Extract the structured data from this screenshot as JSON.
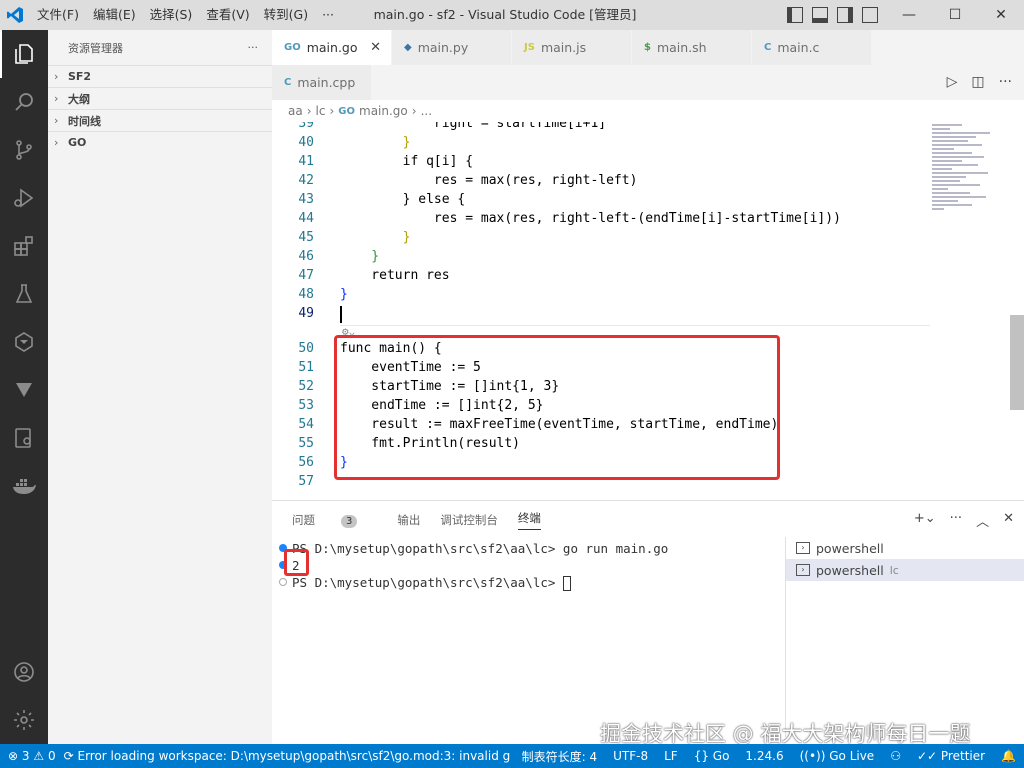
{
  "titlebar": {
    "menu": [
      "文件(F)",
      "编辑(E)",
      "选择(S)",
      "查看(V)",
      "转到(G)",
      "···"
    ],
    "title": "main.go - sf2 - Visual Studio Code [管理员]"
  },
  "sidebar": {
    "title": "资源管理器",
    "sections": [
      "SF2",
      "大纲",
      "时间线",
      "GO"
    ]
  },
  "tabs": [
    {
      "label": "main.go",
      "icon": "GO",
      "active": true,
      "color": "#519aba"
    },
    {
      "label": "main.py",
      "icon": "py",
      "active": false,
      "color": "#3776ab"
    },
    {
      "label": "main.js",
      "icon": "JS",
      "active": false,
      "color": "#cbcb41"
    },
    {
      "label": "main.sh",
      "icon": "$",
      "active": false,
      "color": "#4d5a5e"
    },
    {
      "label": "main.c",
      "icon": "C",
      "active": false,
      "color": "#519aba"
    },
    {
      "label": "main.cpp",
      "icon": "C",
      "active": false,
      "color": "#519aba"
    }
  ],
  "breadcrumb": [
    "aa",
    "lc",
    "main.go",
    "..."
  ],
  "code": {
    "line_numbers": [
      "39",
      "40",
      "41",
      "42",
      "43",
      "44",
      "45",
      "46",
      "47",
      "48",
      "49",
      "50",
      "51",
      "52",
      "53",
      "54",
      "55",
      "56",
      "57"
    ],
    "lines": [
      "            right = startTime[i+1]",
      "        }",
      "        if q[i] {",
      "            res = max(res, right-left)",
      "        } else {",
      "            res = max(res, right-left-(endTime[i]-startTime[i]))",
      "        }",
      "    }",
      "    return res",
      "}",
      "",
      "func main() {",
      "    eventTime := 5",
      "    startTime := []int{1, 3}",
      "    endTime := []int{2, 5}",
      "    result := maxFreeTime(eventTime, startTime, endTime)",
      "    fmt.Println(result)",
      "}",
      ""
    ]
  },
  "panel": {
    "tabs": {
      "problems": "问题",
      "problems_count": "3",
      "output": "输出",
      "debug_console": "调试控制台",
      "terminal": "终端"
    },
    "terminal_lines": [
      "PS D:\\mysetup\\gopath\\src\\sf2\\aa\\lc> go run main.go",
      "2",
      "PS D:\\mysetup\\gopath\\src\\sf2\\aa\\lc> "
    ],
    "shells": [
      {
        "label": "powershell",
        "sub": ""
      },
      {
        "label": "powershell",
        "sub": "lc"
      }
    ]
  },
  "watermark": "掘金技术社区 @ 福大大架构师每日一题",
  "statusbar": {
    "errors": "3",
    "warnings": "0",
    "message": "Error loading workspace: D:\\mysetup\\gopath\\src\\sf2\\go.mod:3: invalid g",
    "tab_size": "制表符长度: 4",
    "encoding": "UTF-8",
    "eol": "LF",
    "language": "Go",
    "go_version": "1.24.6",
    "go_live": "Go Live",
    "prettier": "Prettier"
  }
}
